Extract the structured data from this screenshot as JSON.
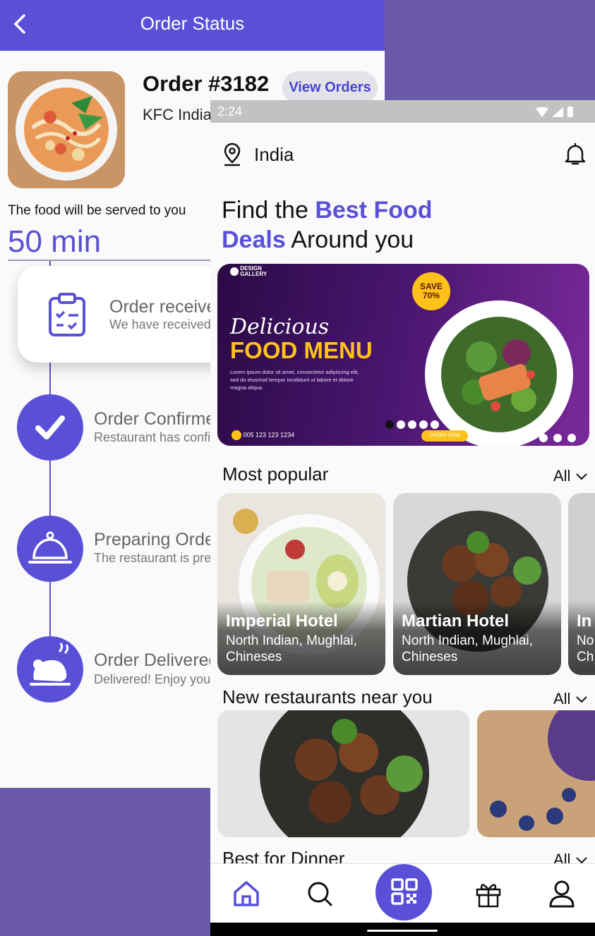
{
  "order_status": {
    "title": "Order Status",
    "order_number": "Order #3182",
    "view_orders_label": "View Orders",
    "restaurant": "KFC India",
    "serve_text": "The food will be served to you",
    "eta": "50 min",
    "steps": [
      {
        "title": "Order received",
        "subtitle": "We have received"
      },
      {
        "title": "Order Confirmed",
        "subtitle": "Restaurant has confirmed"
      },
      {
        "title": "Preparing Order",
        "subtitle": "The restaurant is preparing"
      },
      {
        "title": "Order Delivered",
        "subtitle": "Delivered! Enjoy your meal"
      }
    ]
  },
  "home": {
    "status_bar": {
      "time": "2:24"
    },
    "location": "India",
    "headline": {
      "part1": "Find the ",
      "highlight1": "Best Food",
      "highlight2": "Deals",
      "part2": " Around you"
    },
    "banner": {
      "brand": "DESIGN\nGALLERY",
      "script_text": "Delicious",
      "title": "FOOD MENU",
      "body": "Lorem ipsum dolor sit amet, consectetur adipiscing elit, sed do eiusmod tempor incididunt ut labore et dolore magna aliqua.",
      "save_label": "SAVE\n70%",
      "phone": "005 123 123 1234",
      "cta": "ORDER NOW"
    },
    "carousel": {
      "count": 5,
      "active": 0
    },
    "most_popular": {
      "title": "Most popular",
      "all": "All",
      "cards": [
        {
          "name": "Imperial Hotel",
          "cuisine1": "North Indian, Mughlai,",
          "cuisine2": "Chineses"
        },
        {
          "name": "Martian Hotel",
          "cuisine1": "North Indian, Mughlai,",
          "cuisine2": "Chineses"
        },
        {
          "name": "In",
          "cuisine1": "No",
          "cuisine2": "Ch"
        }
      ]
    },
    "new_restaurants": {
      "title": "New restaurants near you",
      "all": "All"
    },
    "best_dinner": {
      "title": "Best for Dinner",
      "all": "All"
    },
    "nav": [
      "home-icon",
      "search-icon",
      "qr-code-icon",
      "gift-icon",
      "profile-icon"
    ]
  },
  "colors": {
    "accent": "#5a50d8",
    "banner_yellow": "#ffc21a",
    "frame": "#6b5aa8"
  }
}
